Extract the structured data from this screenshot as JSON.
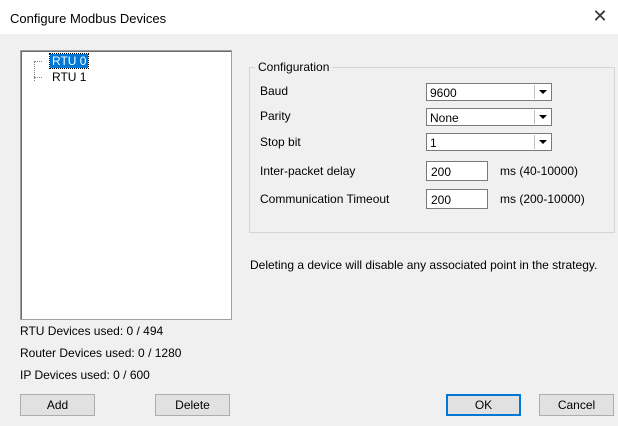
{
  "window": {
    "title": "Configure Modbus Devices",
    "close_glyph": "✕"
  },
  "tree": {
    "items": [
      {
        "label": "RTU 0",
        "selected": true
      },
      {
        "label": "RTU 1",
        "selected": false
      }
    ]
  },
  "stats": {
    "rtu": "RTU Devices used: 0 / 494",
    "router": "Router Devices used: 0 / 1280",
    "ip": "IP Devices used: 0 / 600"
  },
  "config": {
    "caption": "Configuration",
    "baud": {
      "label": "Baud",
      "value": "9600"
    },
    "parity": {
      "label": "Parity",
      "value": "None"
    },
    "stop_bit": {
      "label": "Stop bit",
      "value": "1"
    },
    "inter_packet_delay": {
      "label": "Inter-packet delay",
      "value": "200",
      "unit": "ms (40-10000)"
    },
    "comm_timeout": {
      "label": "Communication Timeout",
      "value": "200",
      "unit": "ms (200-10000)"
    }
  },
  "note": "Deleting a device will disable any associated point in the strategy.",
  "buttons": {
    "add": "Add",
    "delete": "Delete",
    "ok": "OK",
    "cancel": "Cancel"
  }
}
